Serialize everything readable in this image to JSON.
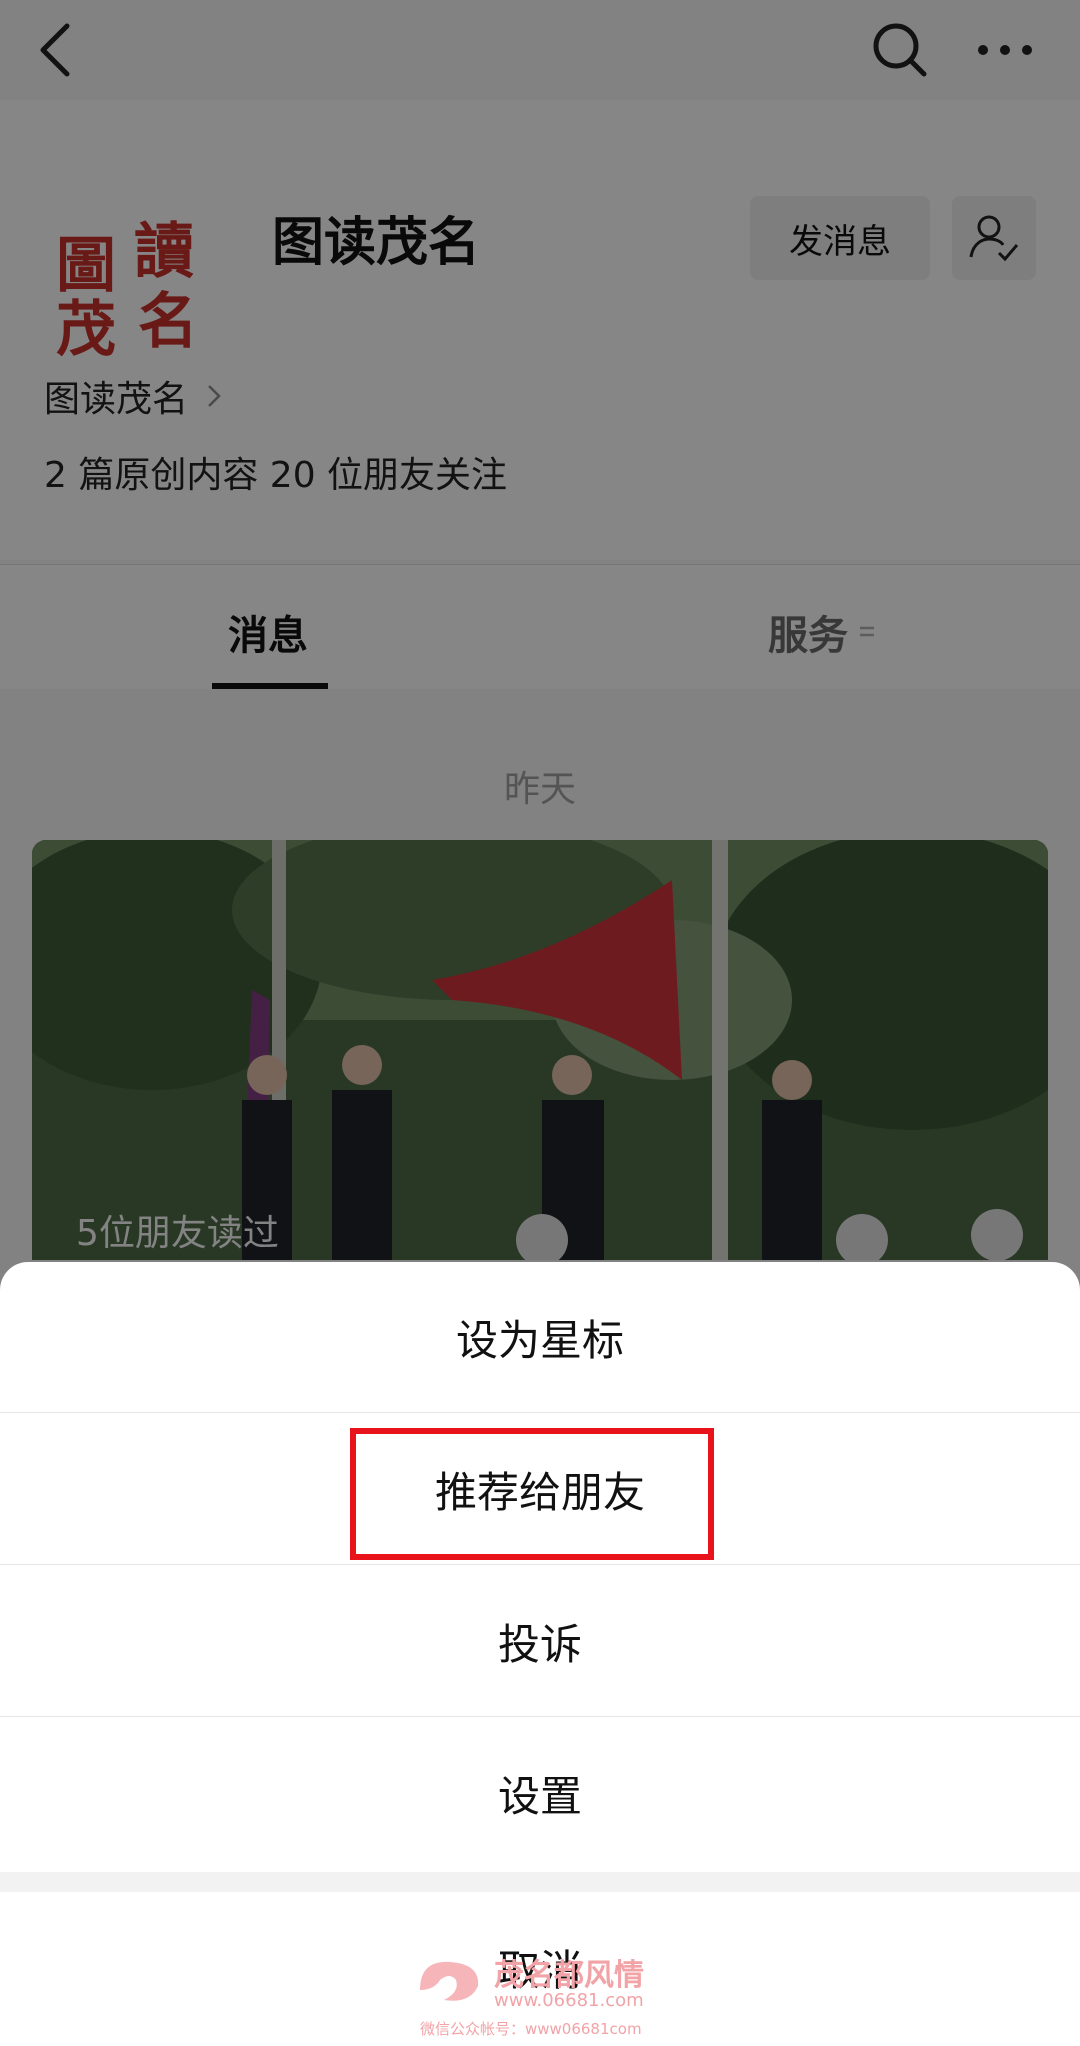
{
  "header": {
    "account_name": "图读茂名",
    "message_button": "发消息",
    "logo_chars": [
      "圖",
      "讀",
      "茂",
      "名"
    ]
  },
  "profile": {
    "account_link": "图读茂名",
    "stats": "2 篇原创内容  20 位朋友关注"
  },
  "tabs": {
    "messages": "消息",
    "services": "服务"
  },
  "feed": {
    "date": "昨天",
    "read_badge": "5位朋友读过"
  },
  "action_sheet": {
    "items": [
      "设为星标",
      "推荐给朋友",
      "投诉",
      "设置"
    ],
    "cancel": "取消"
  },
  "watermark": {
    "line1": "茂名都风情",
    "line2": "www.06681.com",
    "line3": "微信公众帐号：www06681com"
  },
  "colors": {
    "highlight": "#e8131b",
    "logo_red": "#c0302a"
  },
  "icons": [
    "back-arrow-icon",
    "search-icon",
    "more-dots-icon",
    "follow-user-icon",
    "chevron-right-icon",
    "service-menu-icon"
  ]
}
